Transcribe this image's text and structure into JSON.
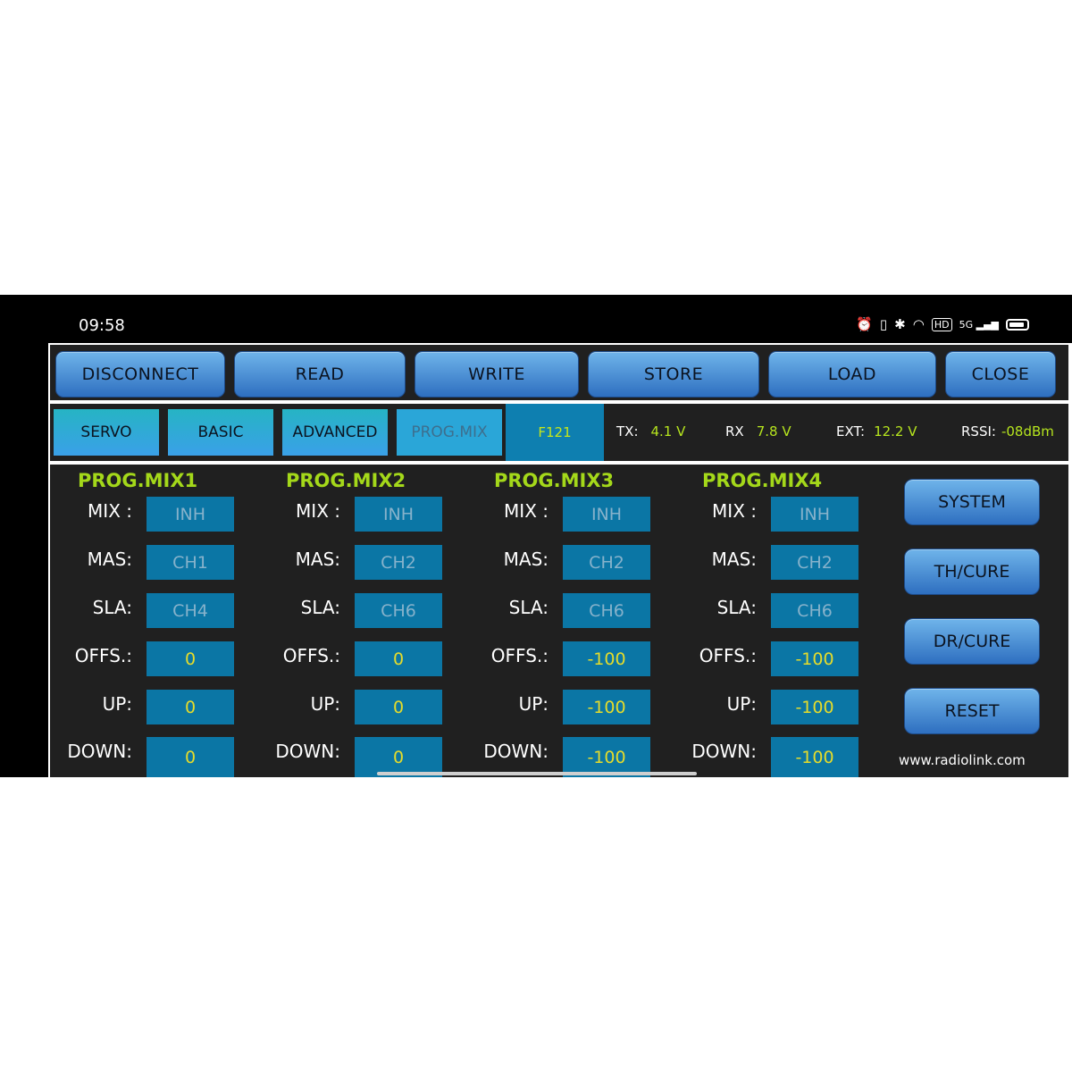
{
  "status_bar": {
    "time": "09:58",
    "icons": [
      "alarm-icon",
      "vibrate-icon",
      "bluetooth-icon",
      "wifi-icon",
      "hd-icon",
      "5g-signal-icon",
      "battery-icon"
    ],
    "hd": "HD",
    "net": "5G"
  },
  "toolbar": {
    "disconnect": "DISCONNECT",
    "read": "READ",
    "write": "WRITE",
    "store": "STORE",
    "load": "LOAD",
    "close": "CLOSE"
  },
  "tabs": {
    "servo": "SERVO",
    "basic": "BASIC",
    "advanced": "ADVANCED",
    "progmix": "PROG.MIX",
    "active": "PROG.MIX"
  },
  "model": "F121",
  "telemetry": {
    "tx_label": "TX:",
    "tx_value": "4.1 V",
    "rx_label": "RX",
    "rx_value": "7.8 V",
    "ext_label": "EXT:",
    "ext_value": "12.2 V",
    "rssi_label": "RSSI:",
    "rssi_value": "-08dBm"
  },
  "row_labels": {
    "mix": "MIX :",
    "mas": "MAS:",
    "sla": "SLA:",
    "offs": "OFFS.:",
    "up": "UP:",
    "down": "DOWN:"
  },
  "mixes": [
    {
      "title": "PROG.MIX1",
      "mix": "INH",
      "mas": "CH1",
      "sla": "CH4",
      "offs": "0",
      "up": "0",
      "down": "0"
    },
    {
      "title": "PROG.MIX2",
      "mix": "INH",
      "mas": "CH2",
      "sla": "CH6",
      "offs": "0",
      "up": "0",
      "down": "0"
    },
    {
      "title": "PROG.MIX3",
      "mix": "INH",
      "mas": "CH2",
      "sla": "CH6",
      "offs": "-100",
      "up": "-100",
      "down": "-100"
    },
    {
      "title": "PROG.MIX4",
      "mix": "INH",
      "mas": "CH2",
      "sla": "CH6",
      "offs": "-100",
      "up": "-100",
      "down": "-100"
    }
  ],
  "side_buttons": {
    "system": "SYSTEM",
    "th_curve": "TH/CURE",
    "dr_curve": "DR/CURE",
    "reset": "RESET"
  },
  "website": "www.radiolink.com",
  "colors": {
    "accent_green": "#a4d81a",
    "value_yellow": "#e6dc2a",
    "cell_blue": "#0b76a5",
    "button_blue": "#3f86d3"
  }
}
